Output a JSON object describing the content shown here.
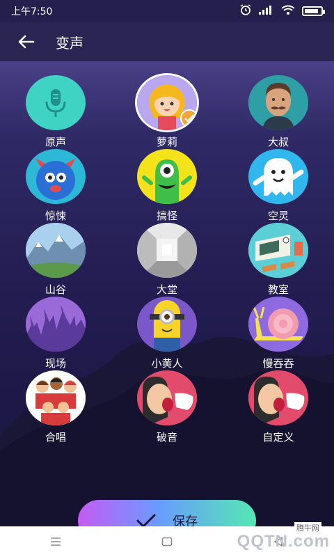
{
  "status": {
    "time": "上午7:50",
    "battery_level": 0.85
  },
  "header": {
    "title": "变声",
    "back_icon": "arrow-left-icon"
  },
  "voices": [
    {
      "label": "原声",
      "icon": "microphone-icon",
      "bg": "#3fd3c4",
      "selected": false
    },
    {
      "label": "萝莉",
      "icon": "girl-avatar",
      "bg": "#6d55c9",
      "selected": true
    },
    {
      "label": "大叔",
      "icon": "mustache-man-avatar",
      "bg": "#2d9fa5",
      "selected": false
    },
    {
      "label": "惊悚",
      "icon": "blue-monster",
      "bg": "#2db8d8",
      "selected": false
    },
    {
      "label": "搞怪",
      "icon": "green-monster",
      "bg": "#f4e21a",
      "selected": false
    },
    {
      "label": "空灵",
      "icon": "ghost",
      "bg": "#2fb7ee",
      "selected": false
    },
    {
      "label": "山谷",
      "icon": "mountain-valley",
      "bg": "#9fc9e8",
      "selected": false
    },
    {
      "label": "大堂",
      "icon": "hall-room",
      "bg": "#bdbdbd",
      "selected": false
    },
    {
      "label": "教室",
      "icon": "classroom",
      "bg": "#5ccfd6",
      "selected": false
    },
    {
      "label": "现场",
      "icon": "concert-crowd",
      "bg": "#8b5ed0",
      "selected": false
    },
    {
      "label": "小黄人",
      "icon": "minion",
      "bg": "#7a58c9",
      "selected": false
    },
    {
      "label": "慢吞吞",
      "icon": "snail",
      "bg": "#8e6ae0",
      "selected": false
    },
    {
      "label": "合唱",
      "icon": "choir",
      "bg": "#ffffff",
      "selected": false
    },
    {
      "label": "破音",
      "icon": "shouting-man",
      "bg": "#e34b6c",
      "selected": false
    },
    {
      "label": "自定义",
      "icon": "shouting-man-custom",
      "bg": "#e34b6c",
      "selected": false
    }
  ],
  "save_button": {
    "label": "保存",
    "icon": "check-icon"
  },
  "watermark": {
    "text": "QQTN.com",
    "small_text": "腾牛网"
  },
  "colors": {
    "accent_orange": "#f4a63a",
    "gradient_start": "#c55bf2",
    "gradient_end": "#54e8b3"
  }
}
